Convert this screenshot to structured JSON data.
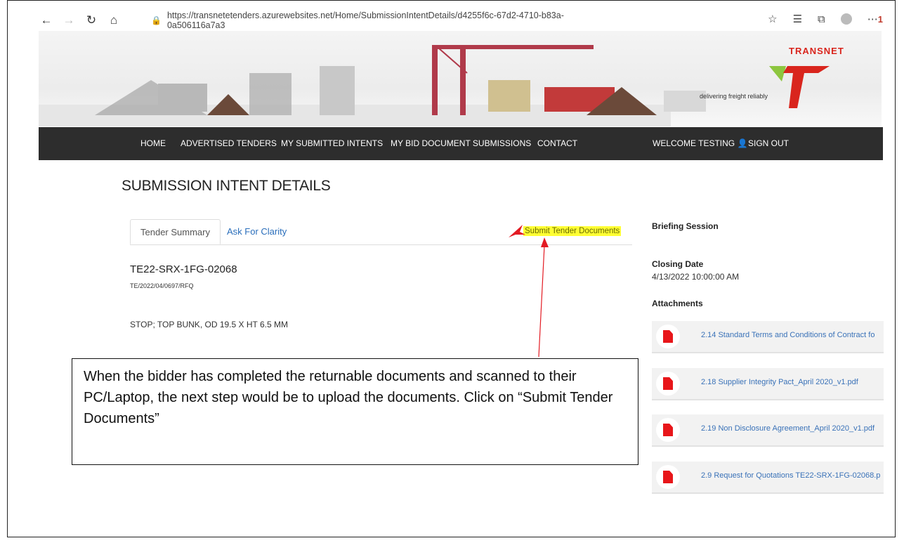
{
  "browser": {
    "url": "https://transnetetenders.azurewebsites.net/Home/SubmissionIntentDetails/d4255f6c-67d2-4710-b83a-0a506116a7a3",
    "notification_count": "1"
  },
  "brand": {
    "name": "TRANSNET",
    "tagline": "delivering freight reliably",
    "accent_color": "#d9251d"
  },
  "nav": {
    "home": "HOME",
    "advertised": "ADVERTISED TENDERS",
    "intents": "MY SUBMITTED INTENTS",
    "bids": "MY BID DOCUMENT SUBMISSIONS",
    "contact": "CONTACT",
    "welcome": "WELCOME TESTING",
    "signout": "SIGN OUT"
  },
  "page": {
    "title": "SUBMISSION INTENT DETAILS",
    "tabs": [
      "Tender Summary",
      "Ask For Clarity"
    ],
    "submit_link": "Submit Tender Documents",
    "tender_code": "TE22-SRX-1FG-02068",
    "tender_ref": "TE/2022/04/0697/RFQ",
    "tender_desc": "STOP; TOP BUNK, OD 19.5 X HT 6.5 MM"
  },
  "sidebar": {
    "briefing_label": "Briefing Session",
    "closing_label": "Closing Date",
    "closing_value": "4/13/2022 10:00:00 AM",
    "attachments_label": "Attachments",
    "attachments": [
      "2.14 Standard Terms and Conditions of Contract fo",
      "2.18 Supplier Integrity Pact_April 2020_v1.pdf",
      "2.19 Non Disclosure Agreement_April 2020_v1.pdf",
      "2.9 Request for Quotations TE22-SRX-1FG-02068.p"
    ]
  },
  "callout": {
    "text": "When the bidder has completed the returnable documents and scanned to their PC/Laptop, the next step would be to upload the documents. Click on “Submit Tender Documents”"
  }
}
